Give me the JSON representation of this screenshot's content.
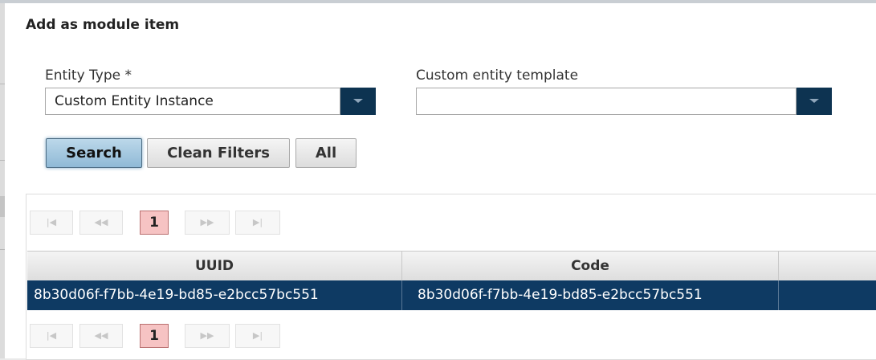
{
  "dialog": {
    "title": "Add as module item"
  },
  "filters": {
    "entity_type": {
      "label": "Entity Type *",
      "value": "Custom Entity Instance"
    },
    "custom_template": {
      "label": "Custom entity template",
      "value": ""
    }
  },
  "buttons": {
    "search": "Search",
    "clean_filters": "Clean Filters",
    "all": "All"
  },
  "pager": {
    "first": "|◀",
    "prev": "◀◀",
    "current_page": "1",
    "next": "▶▶",
    "last": "▶|"
  },
  "table": {
    "columns": [
      "UUID",
      "Code",
      ""
    ],
    "rows": [
      {
        "uuid": "8b30d06f-f7bb-4e19-bd85-e2bcc57bc551",
        "code": "8b30d06f-f7bb-4e19-bd85-e2bcc57bc551",
        "extra": "",
        "selected": true
      }
    ]
  },
  "colors": {
    "dropdown_button": "#0d3351",
    "selected_row": "#0e3a63",
    "active_page": "#f6c3c3",
    "search_button": "#a7c9e0"
  },
  "icons": {
    "dropdown": "chevron-down-icon",
    "first": "first-page-icon",
    "prev": "previous-page-icon",
    "next": "next-page-icon",
    "last": "last-page-icon"
  }
}
